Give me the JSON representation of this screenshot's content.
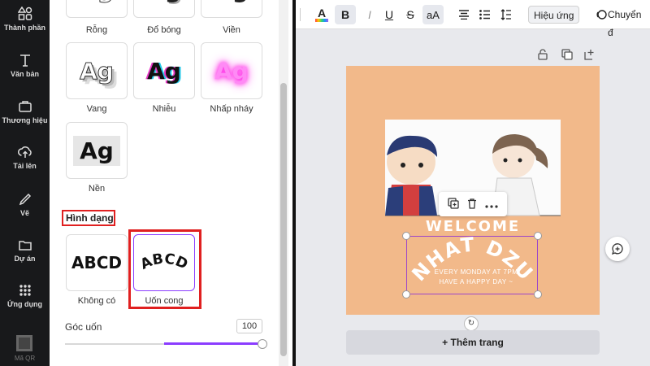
{
  "sidebar": {
    "items": [
      {
        "label": "Thành phần",
        "icon": "elements-icon"
      },
      {
        "label": "Văn bản",
        "icon": "text-icon"
      },
      {
        "label": "Thương hiệu",
        "icon": "brand-icon"
      },
      {
        "label": "Tải lên",
        "icon": "upload-icon"
      },
      {
        "label": "Vẽ",
        "icon": "draw-icon"
      },
      {
        "label": "Dự án",
        "icon": "folder-icon"
      },
      {
        "label": "Ứng dụng",
        "icon": "apps-icon"
      }
    ],
    "qr_label": "Mã QR"
  },
  "effects": {
    "styles": [
      {
        "label": "Rỗng",
        "preview": "Ag"
      },
      {
        "label": "Đổ bóng",
        "preview": "Ag"
      },
      {
        "label": "Viền",
        "preview": "Ag"
      },
      {
        "label": "Vang",
        "preview": "Ag"
      },
      {
        "label": "Nhiễu",
        "preview": "Ag"
      },
      {
        "label": "Nhấp nháy",
        "preview": "Ag"
      },
      {
        "label": "Nền",
        "preview": "Ag"
      }
    ],
    "shape_section_title": "Hình dạng",
    "shapes": [
      {
        "label": "Không có",
        "preview": "ABCD",
        "selected": false
      },
      {
        "label": "Uốn cong",
        "preview": "ABCD",
        "selected": true
      }
    ],
    "curve": {
      "label": "Góc uốn",
      "value": "100"
    }
  },
  "toolbar": {
    "effects_label": "Hiệu ứng",
    "animate_label": "Chuyển đ",
    "case_label": "aA",
    "bold_label": "B",
    "italic_label": "I",
    "underline_label": "U",
    "strike_label": "S",
    "font_color_letter": "A"
  },
  "design": {
    "welcome": "WELCOME",
    "curved_title": "NHAT DZU",
    "line1": "EVERY MONDAY AT 7PM",
    "line2": "HAVE A HAPPY DAY ~",
    "add_page_label": "+ Thêm trang"
  },
  "colors": {
    "rail_bg": "#18191b",
    "accent_purple": "#8b3dff",
    "selection_purple": "#9c46c9",
    "highlight_red": "#e02020",
    "page_bg": "#f2b98a"
  }
}
